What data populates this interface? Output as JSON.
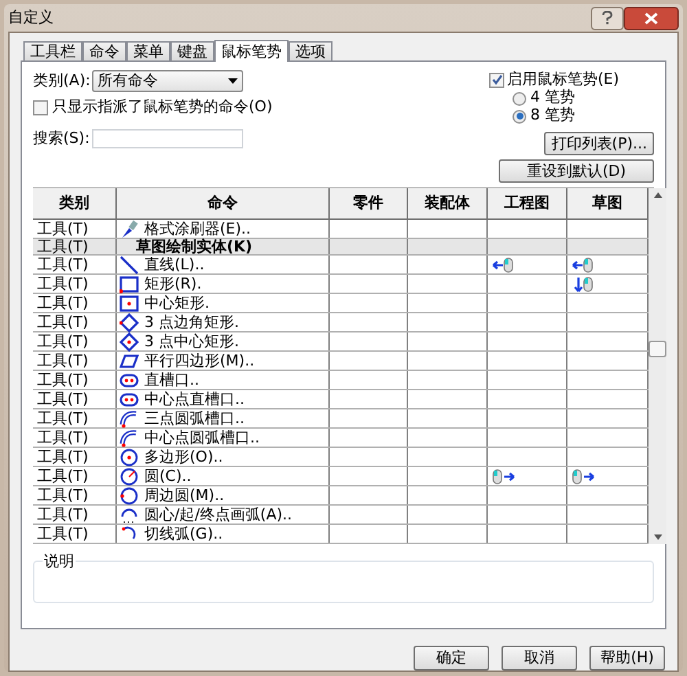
{
  "window": {
    "title": "自定义"
  },
  "tabs": [
    {
      "label": "工具栏",
      "selected": false
    },
    {
      "label": "命令",
      "selected": false
    },
    {
      "label": "菜单",
      "selected": false
    },
    {
      "label": "键盘",
      "selected": false
    },
    {
      "label": "鼠标笔势",
      "selected": true
    },
    {
      "label": "选项",
      "selected": false
    }
  ],
  "category": {
    "label": "类别(A):",
    "value": "所有命令"
  },
  "only_assigned": {
    "label": "只显示指派了鼠标笔势的命令(O)",
    "checked": false
  },
  "search": {
    "label": "搜索(S):"
  },
  "enable_gestures": {
    "label": "启用鼠标笔势(E)",
    "checked": true
  },
  "gesture_count": [
    {
      "label": "4 笔势",
      "selected": false
    },
    {
      "label": "8 笔势",
      "selected": true
    }
  ],
  "print_button": "打印列表(P)...",
  "reset_button": "重设到默认(D)",
  "table": {
    "columns": [
      "类别",
      "命令",
      "零件",
      "装配体",
      "工程图",
      "草图"
    ],
    "rows": [
      {
        "kind": "command",
        "category": "工具(T)",
        "command": "格式涂刷器(E).."
      },
      {
        "kind": "group",
        "category": "工具(T)",
        "command": "草图绘制实体(K)"
      },
      {
        "kind": "command",
        "category": "工具(T)",
        "command": "直线(L)..",
        "drawing": {
          "kind": "left"
        },
        "sketch": {
          "kind": "left"
        }
      },
      {
        "kind": "command",
        "category": "工具(T)",
        "command": "矩形(R).",
        "sketch": {
          "kind": "down"
        }
      },
      {
        "kind": "command",
        "category": "工具(T)",
        "command": "中心矩形."
      },
      {
        "kind": "command",
        "category": "工具(T)",
        "command": "3 点边角矩形."
      },
      {
        "kind": "command",
        "category": "工具(T)",
        "command": "3 点中心矩形."
      },
      {
        "kind": "command",
        "category": "工具(T)",
        "command": "平行四边形(M).."
      },
      {
        "kind": "command",
        "category": "工具(T)",
        "command": "直槽口.."
      },
      {
        "kind": "command",
        "category": "工具(T)",
        "command": "中心点直槽口.."
      },
      {
        "kind": "command",
        "category": "工具(T)",
        "command": "三点圆弧槽口.."
      },
      {
        "kind": "command",
        "category": "工具(T)",
        "command": "中心点圆弧槽口.."
      },
      {
        "kind": "command",
        "category": "工具(T)",
        "command": "多边形(O).."
      },
      {
        "kind": "command",
        "category": "工具(T)",
        "command": "圆(C)..",
        "drawing": {
          "kind": "right"
        },
        "sketch": {
          "kind": "right"
        }
      },
      {
        "kind": "command",
        "category": "工具(T)",
        "command": "周边圆(M).."
      },
      {
        "kind": "command",
        "category": "工具(T)",
        "command": "圆心/起/终点画弧(A).."
      },
      {
        "kind": "command",
        "category": "工具(T)",
        "command": "切线弧(G).."
      }
    ]
  },
  "description": {
    "label": "说明"
  },
  "buttons": [
    "确定",
    "取消",
    "帮助(H)"
  ]
}
